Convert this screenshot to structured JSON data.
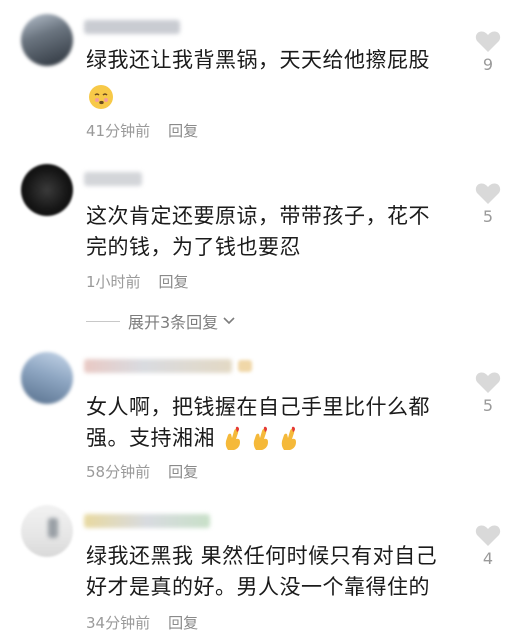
{
  "comments": [
    {
      "text": "绿我还让我背黑锅，天天给他擦屁股",
      "time": "41分钟前",
      "reply": "回复",
      "likes": "9"
    },
    {
      "text": "这次肯定还要原谅，带带孩子，花不完的钱，为了钱也要忍",
      "time": "1小时前",
      "reply": "回复",
      "likes": "5"
    },
    {
      "text": "女人啊，把钱握在自己手里比什么都强。支持湘湘",
      "time": "58分钟前",
      "reply": "回复",
      "likes": "5"
    },
    {
      "text": "绿我还黑我 果然任何时候只有对自己好才是真的好。男人没一个靠得住的",
      "time": "34分钟前",
      "reply": "回复",
      "likes": "4"
    }
  ],
  "expand_replies": {
    "label": "展开3条回复"
  },
  "icons": {
    "like": "heart-icon",
    "expand": "chevron-down-icon",
    "emoji_face": "face-emoji",
    "emoji_hand": "finger-heart-emoji"
  },
  "colors": {
    "text": "#1b1b1b",
    "meta": "#9a9a9a",
    "heart": "#d9d9d9"
  }
}
